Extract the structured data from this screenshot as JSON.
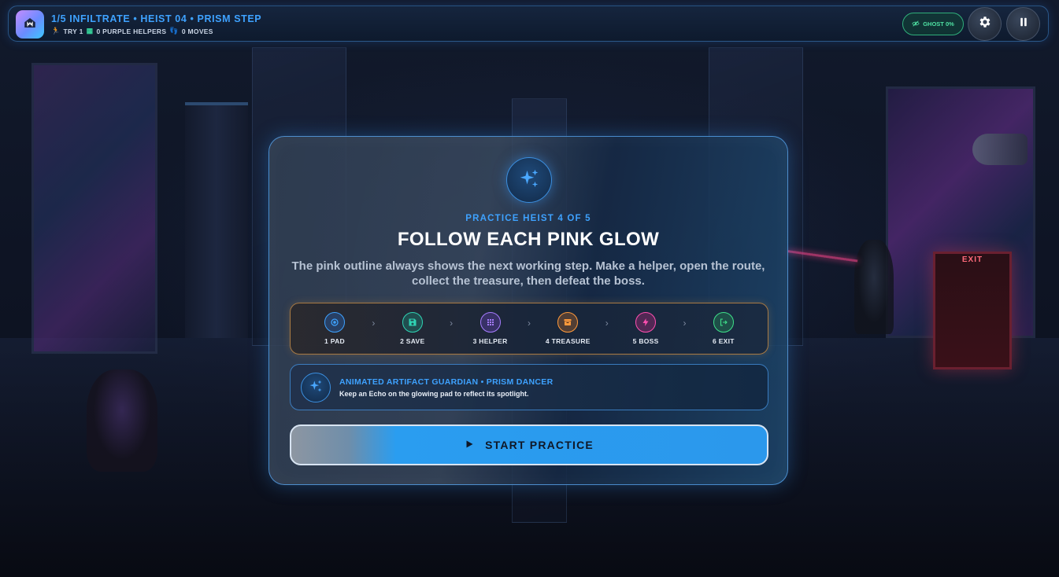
{
  "hud": {
    "title": "1/5 INFILTRATE • HEIST 04 • PRISM STEP",
    "try_label": "TRY 1",
    "helpers_label": "0 PURPLE HELPERS",
    "moves_label": "0 MOVES",
    "ghost_label": "GHOST 0%",
    "icons": [
      "home-icon",
      "runner-icon",
      "helpers-icon",
      "moves-icon",
      "eye-off-icon",
      "gear-icon",
      "pause-icon"
    ]
  },
  "scene": {
    "exit_sign": "EXIT"
  },
  "modal": {
    "kicker": "PRACTICE HEIST 4 OF 5",
    "title": "FOLLOW EACH PINK GLOW",
    "description": "The pink outline always shows the next working step. Make a helper, open the route, collect the treasure, then defeat the boss.",
    "steps": [
      {
        "label": "1 PAD",
        "icon": "pad-icon",
        "color": "#3ea2ff"
      },
      {
        "label": "2 SAVE",
        "icon": "save-icon",
        "color": "#2fd3b4"
      },
      {
        "label": "3 HELPER",
        "icon": "helper-grid-icon",
        "color": "#a67cff"
      },
      {
        "label": "4 TREASURE",
        "icon": "treasure-icon",
        "color": "#ff9a3c"
      },
      {
        "label": "5 BOSS",
        "icon": "bolt-icon",
        "color": "#ff4fb0"
      },
      {
        "label": "6 EXIT",
        "icon": "exit-icon",
        "color": "#3fe08a"
      }
    ],
    "guardian": {
      "title": "ANIMATED ARTIFACT GUARDIAN • PRISM DANCER",
      "text": "Keep an Echo on the glowing pad to reflect its spotlight.",
      "icon": "sparkles-icon"
    },
    "start_button": "START PRACTICE"
  },
  "colors": {
    "accent": "#3ea2ff",
    "ghost": "#4fe0a2",
    "steps_border": "#a87a44"
  }
}
